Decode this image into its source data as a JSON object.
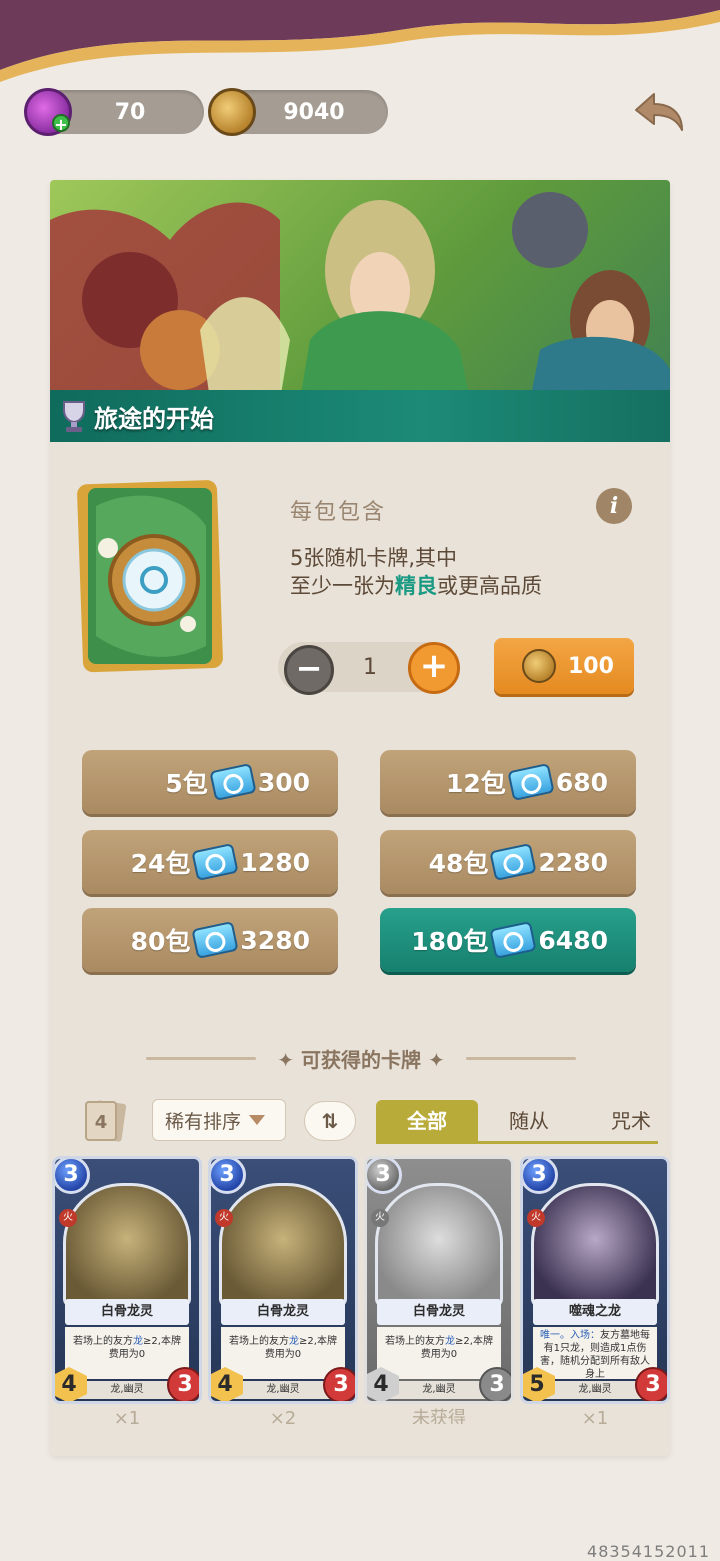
{
  "currency": {
    "gems": "70",
    "coins": "9040"
  },
  "banner": {
    "title": "旅途的开始"
  },
  "pack": {
    "contains_label": "每包包含",
    "desc_line1": "5张随机卡牌,其中",
    "desc_line2_prefix": "至少一张为",
    "desc_line2_highlight": "精良",
    "desc_line2_suffix": "或更高品质",
    "info": "i",
    "quantity": "1",
    "minus": "−",
    "plus": "+",
    "price": "100"
  },
  "bundles": [
    {
      "label": "5包",
      "price": "300"
    },
    {
      "label": "12包",
      "price": "680"
    },
    {
      "label": "24包",
      "price": "1280"
    },
    {
      "label": "48包",
      "price": "2280"
    },
    {
      "label": "80包",
      "price": "3280"
    },
    {
      "label": "180包",
      "price": "6480"
    }
  ],
  "section": {
    "title": "✦ 可获得的卡牌 ✦"
  },
  "filters": {
    "count": "4",
    "sort_label": "稀有排序",
    "order_symbol": "⇅",
    "tabs": [
      "全部",
      "随从",
      "咒术"
    ]
  },
  "cards": [
    {
      "cost": "3",
      "element": "火",
      "name": "白骨龙灵",
      "text_prefix": "若场上的友方",
      "text_kw": "龙",
      "text_suffix": "≥2,本牌费用为0",
      "tribe": "龙,幽灵",
      "attack": "4",
      "health": "3",
      "foot": "×1"
    },
    {
      "cost": "3",
      "element": "火",
      "name": "白骨龙灵",
      "text_prefix": "若场上的友方",
      "text_kw": "龙",
      "text_suffix": "≥2,本牌费用为0",
      "tribe": "龙,幽灵",
      "attack": "4",
      "health": "3",
      "foot": "×2"
    },
    {
      "cost": "3",
      "element": "火",
      "name": "白骨龙灵",
      "text_prefix": "若场上的友方",
      "text_kw": "龙",
      "text_suffix": "≥2,本牌费用为0",
      "tribe": "龙,幽灵",
      "attack": "4",
      "health": "3",
      "foot": "未获得"
    },
    {
      "cost": "3",
      "element": "火",
      "name": "噬魂之龙",
      "text_prefix": "唯一。入场：",
      "text_kw": "",
      "text_suffix": "友方墓地每有1只龙，则造成1点伤害，随机分配到所有敌人身上",
      "tribe": "龙,幽灵",
      "attack": "5",
      "health": "3",
      "foot": "×1"
    }
  ],
  "watermark": "48354152011"
}
